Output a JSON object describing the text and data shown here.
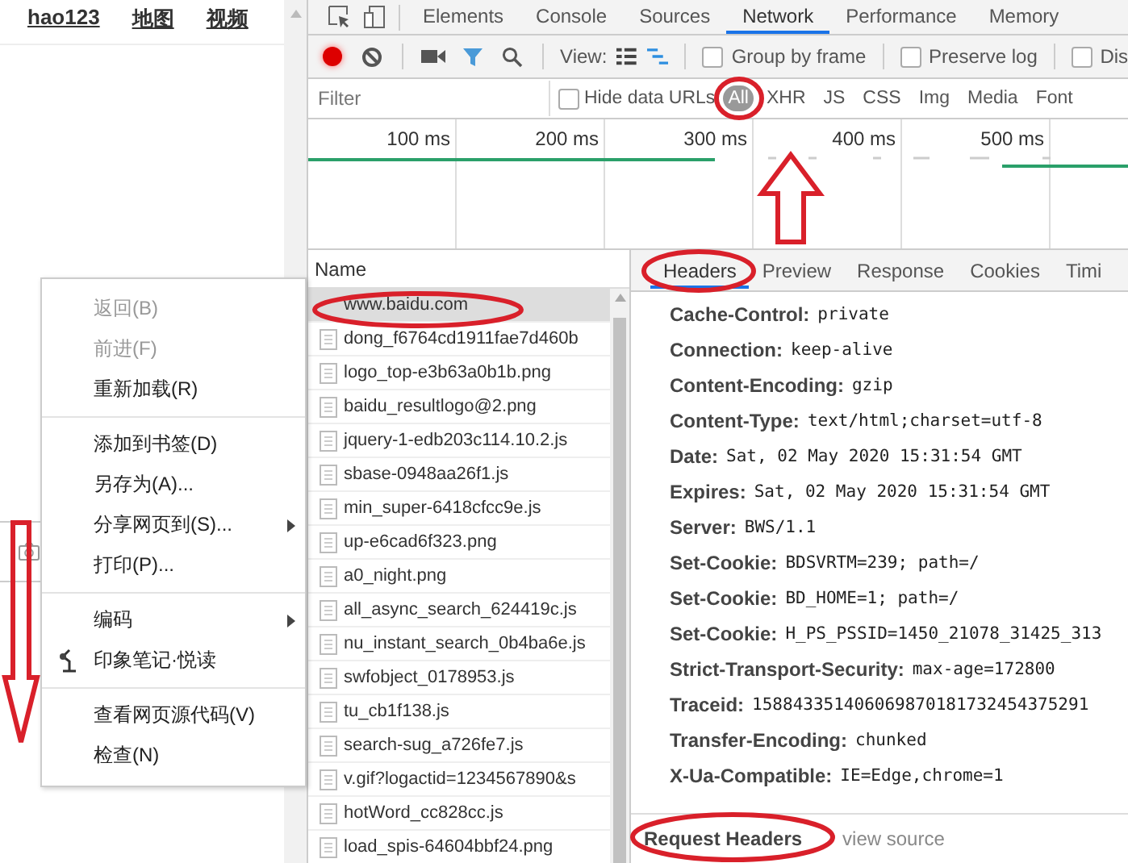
{
  "page": {
    "links": [
      "hao123",
      "地图",
      "视频"
    ]
  },
  "devtools": {
    "tabs": [
      {
        "label": "Elements",
        "selected": false
      },
      {
        "label": "Console",
        "selected": false
      },
      {
        "label": "Sources",
        "selected": false
      },
      {
        "label": "Network",
        "selected": true
      },
      {
        "label": "Performance",
        "selected": false
      },
      {
        "label": "Memory",
        "selected": false
      }
    ],
    "toolbar": {
      "recording": true,
      "view_label": "View:",
      "checkboxes": [
        {
          "label": "Group by frame",
          "checked": false
        },
        {
          "label": "Preserve log",
          "checked": false
        },
        {
          "label": "Dis",
          "checked": false
        }
      ]
    },
    "filter": {
      "placeholder": "Filter",
      "hide_data_urls": {
        "label": "Hide data URLs",
        "checked": false
      },
      "types": [
        {
          "label": "All",
          "selected": true
        },
        {
          "label": "XHR",
          "selected": false
        },
        {
          "label": "JS",
          "selected": false
        },
        {
          "label": "CSS",
          "selected": false
        },
        {
          "label": "Img",
          "selected": false
        },
        {
          "label": "Media",
          "selected": false
        },
        {
          "label": "Font",
          "selected": false
        }
      ]
    },
    "timeline": {
      "ticks": [
        "100 ms",
        "200 ms",
        "300 ms",
        "400 ms",
        "500 ms"
      ]
    },
    "requests": {
      "column": "Name",
      "rows": [
        {
          "name": "www.baidu.com",
          "selected": true
        },
        {
          "name": "dong_f6764cd1911fae7d460b",
          "selected": false
        },
        {
          "name": "logo_top-e3b63a0b1b.png",
          "selected": false
        },
        {
          "name": "baidu_resultlogo@2.png",
          "selected": false
        },
        {
          "name": "jquery-1-edb203c114.10.2.js",
          "selected": false
        },
        {
          "name": "sbase-0948aa26f1.js",
          "selected": false
        },
        {
          "name": "min_super-6418cfcc9e.js",
          "selected": false
        },
        {
          "name": "up-e6cad6f323.png",
          "selected": false
        },
        {
          "name": "a0_night.png",
          "selected": false
        },
        {
          "name": "all_async_search_624419c.js",
          "selected": false
        },
        {
          "name": "nu_instant_search_0b4ba6e.js",
          "selected": false
        },
        {
          "name": "swfobject_0178953.js",
          "selected": false
        },
        {
          "name": "tu_cb1f138.js",
          "selected": false
        },
        {
          "name": "search-sug_a726fe7.js",
          "selected": false
        },
        {
          "name": "v.gif?logactid=1234567890&s",
          "selected": false
        },
        {
          "name": "hotWord_cc828cc.js",
          "selected": false
        },
        {
          "name": "load_spis-64604bbf24.png",
          "selected": false
        }
      ]
    },
    "detail": {
      "tabs": [
        {
          "label": "Headers",
          "selected": true
        },
        {
          "label": "Preview",
          "selected": false
        },
        {
          "label": "Response",
          "selected": false
        },
        {
          "label": "Cookies",
          "selected": false
        },
        {
          "label": "Timi",
          "selected": false
        }
      ],
      "headers": [
        {
          "name": "Cache-Control:",
          "value": "private"
        },
        {
          "name": "Connection:",
          "value": "keep-alive"
        },
        {
          "name": "Content-Encoding:",
          "value": "gzip"
        },
        {
          "name": "Content-Type:",
          "value": "text/html;charset=utf-8"
        },
        {
          "name": "Date:",
          "value": "Sat, 02 May 2020 15:31:54 GMT"
        },
        {
          "name": "Expires:",
          "value": "Sat, 02 May 2020 15:31:54 GMT"
        },
        {
          "name": "Server:",
          "value": "BWS/1.1"
        },
        {
          "name": "Set-Cookie:",
          "value": "BDSVRTM=239; path=/"
        },
        {
          "name": "Set-Cookie:",
          "value": "BD_HOME=1; path=/"
        },
        {
          "name": "Set-Cookie:",
          "value": "H_PS_PSSID=1450_21078_31425_313"
        },
        {
          "name": "Strict-Transport-Security:",
          "value": "max-age=172800"
        },
        {
          "name": "Traceid:",
          "value": "158843351406069870181732454375291"
        },
        {
          "name": "Transfer-Encoding:",
          "value": "chunked"
        },
        {
          "name": "X-Ua-Compatible:",
          "value": "IE=Edge,chrome=1"
        }
      ],
      "section": "Request Headers",
      "view_source": "view source"
    }
  },
  "context_menu": {
    "groups": [
      {
        "items": [
          {
            "label": "返回(B)",
            "disabled": true,
            "submenu": false
          },
          {
            "label": "前进(F)",
            "disabled": true,
            "submenu": false
          },
          {
            "label": "重新加载(R)",
            "disabled": false,
            "submenu": false
          }
        ]
      },
      {
        "items": [
          {
            "label": "添加到书签(D)",
            "disabled": false,
            "submenu": false
          },
          {
            "label": "另存为(A)...",
            "disabled": false,
            "submenu": false
          },
          {
            "label": "分享网页到(S)...",
            "disabled": false,
            "submenu": true
          },
          {
            "label": "打印(P)...",
            "disabled": false,
            "submenu": false
          }
        ]
      },
      {
        "items": [
          {
            "label": "编码",
            "disabled": false,
            "submenu": true
          },
          {
            "label": "印象笔记·悦读",
            "disabled": false,
            "submenu": false,
            "kind": "icon"
          }
        ]
      },
      {
        "items": [
          {
            "label": "查看网页源代码(V)",
            "disabled": false,
            "submenu": false
          },
          {
            "label": "检查(N)",
            "disabled": false,
            "submenu": false
          }
        ]
      }
    ]
  }
}
